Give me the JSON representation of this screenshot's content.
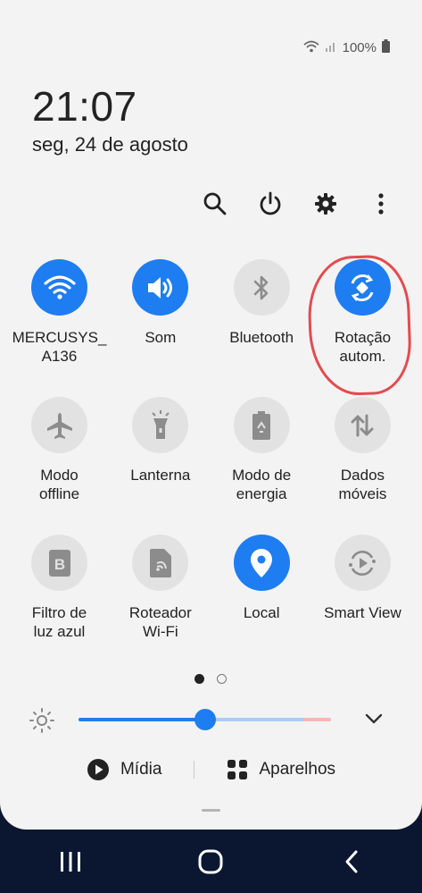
{
  "status": {
    "battery": "100%"
  },
  "clock": {
    "time": "21:07",
    "date": "seg, 24 de agosto"
  },
  "toolbar": {
    "icons": [
      "search-icon",
      "power-icon",
      "gear-icon",
      "more-icon"
    ]
  },
  "tiles": [
    {
      "label": "MERCUSYS_\nA136",
      "icon": "wifi-icon",
      "on": true
    },
    {
      "label": "Som",
      "icon": "volume-icon",
      "on": true
    },
    {
      "label": "Bluetooth",
      "icon": "bluetooth-icon",
      "on": false
    },
    {
      "label": "Rotação\nautom.",
      "icon": "rotation-icon",
      "on": true
    },
    {
      "label": "Modo\noffline",
      "icon": "airplane-icon",
      "on": false
    },
    {
      "label": "Lanterna",
      "icon": "flashlight-icon",
      "on": false
    },
    {
      "label": "Modo de\nenergia",
      "icon": "battery-saver-icon",
      "on": false
    },
    {
      "label": "Dados\nmóveis",
      "icon": "data-arrows-icon",
      "on": false
    },
    {
      "label": "Filtro de\nluz azul",
      "icon": "blue-light-icon",
      "on": false
    },
    {
      "label": "Roteador\nWi-Fi",
      "icon": "hotspot-icon",
      "on": false
    },
    {
      "label": "Local",
      "icon": "location-icon",
      "on": true
    },
    {
      "label": "Smart View",
      "icon": "smart-view-icon",
      "on": false
    }
  ],
  "pager": {
    "current": 1,
    "total": 2
  },
  "brightness": {
    "level": 0.5
  },
  "bottom": {
    "media_label": "Mídia",
    "devices_label": "Aparelhos"
  },
  "colors": {
    "accent": "#1e7df0",
    "annotation": "#e34b50"
  }
}
